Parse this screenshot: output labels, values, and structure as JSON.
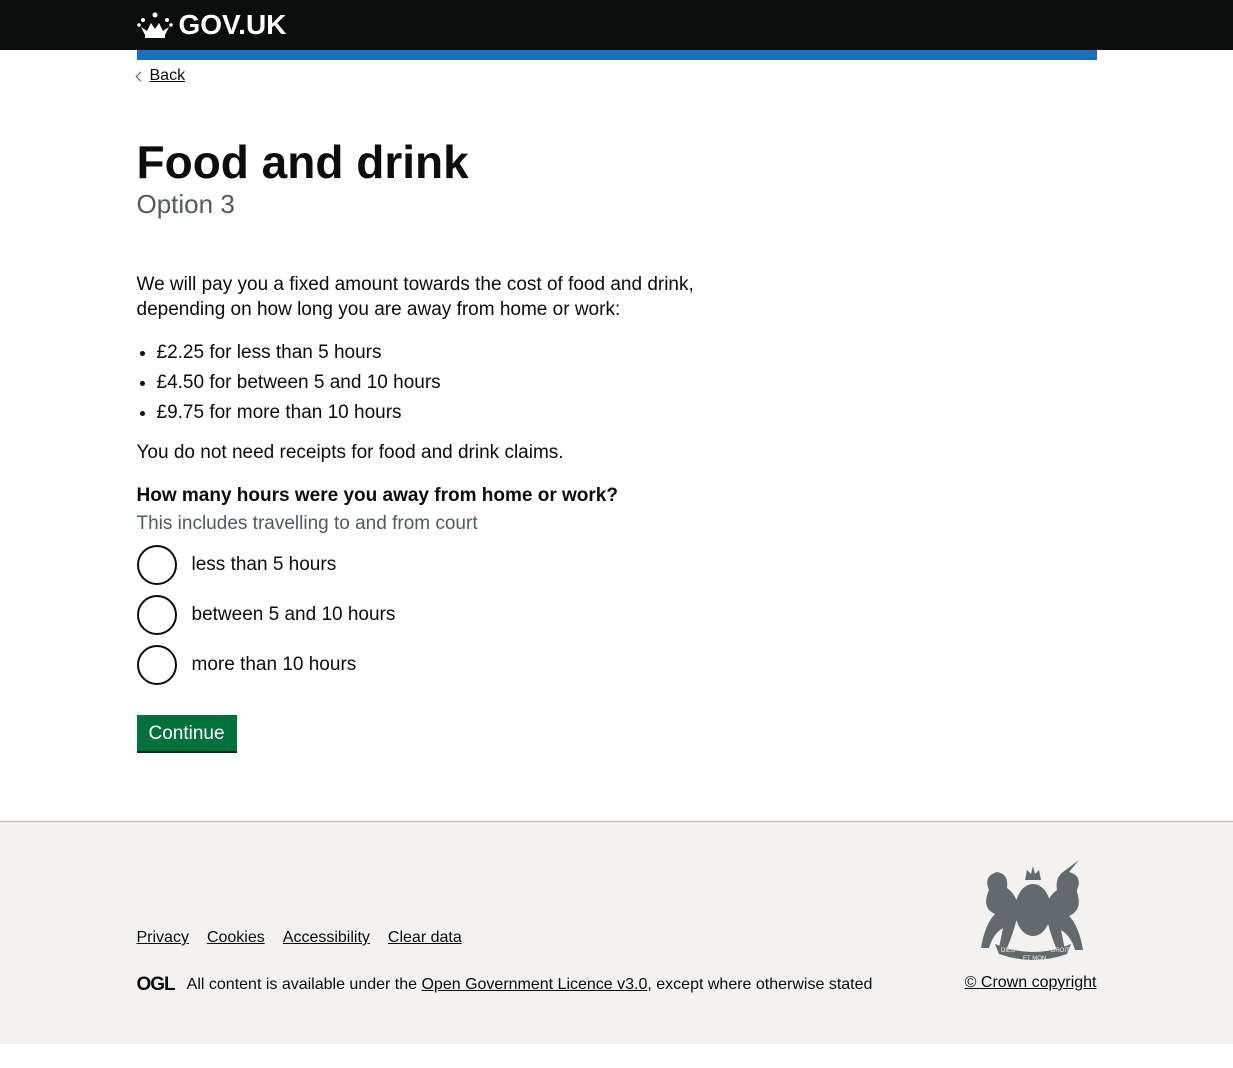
{
  "header": {
    "logo_text": "GOV.UK"
  },
  "back_label": "Back",
  "page": {
    "title": "Food and drink",
    "caption": "Option 3",
    "intro": "We will pay you a fixed amount towards the cost of food and drink, depending on how long you are away from home or work:",
    "bullets": [
      "£2.25 for less than 5 hours",
      "£4.50 for between 5 and 10 hours",
      "£9.75 for more than 10 hours"
    ],
    "note": "You do not need receipts for food and drink claims.",
    "question": "How many hours were you away from home or work?",
    "hint": "This includes travelling to and from court",
    "options": [
      "less than 5 hours",
      "between 5 and 10 hours",
      "more than 10 hours"
    ],
    "continue_label": "Continue"
  },
  "footer": {
    "links": [
      "Privacy",
      "Cookies",
      "Accessibility",
      "Clear data"
    ],
    "ogl": "OGL",
    "licence_prefix": "All content is available under the ",
    "licence_link": "Open Government Licence v3.0",
    "licence_suffix": ", except where otherwise stated",
    "crest_motto": [
      "DIEU",
      "ET MON",
      "DROIT"
    ],
    "copyright": "© Crown copyright"
  }
}
